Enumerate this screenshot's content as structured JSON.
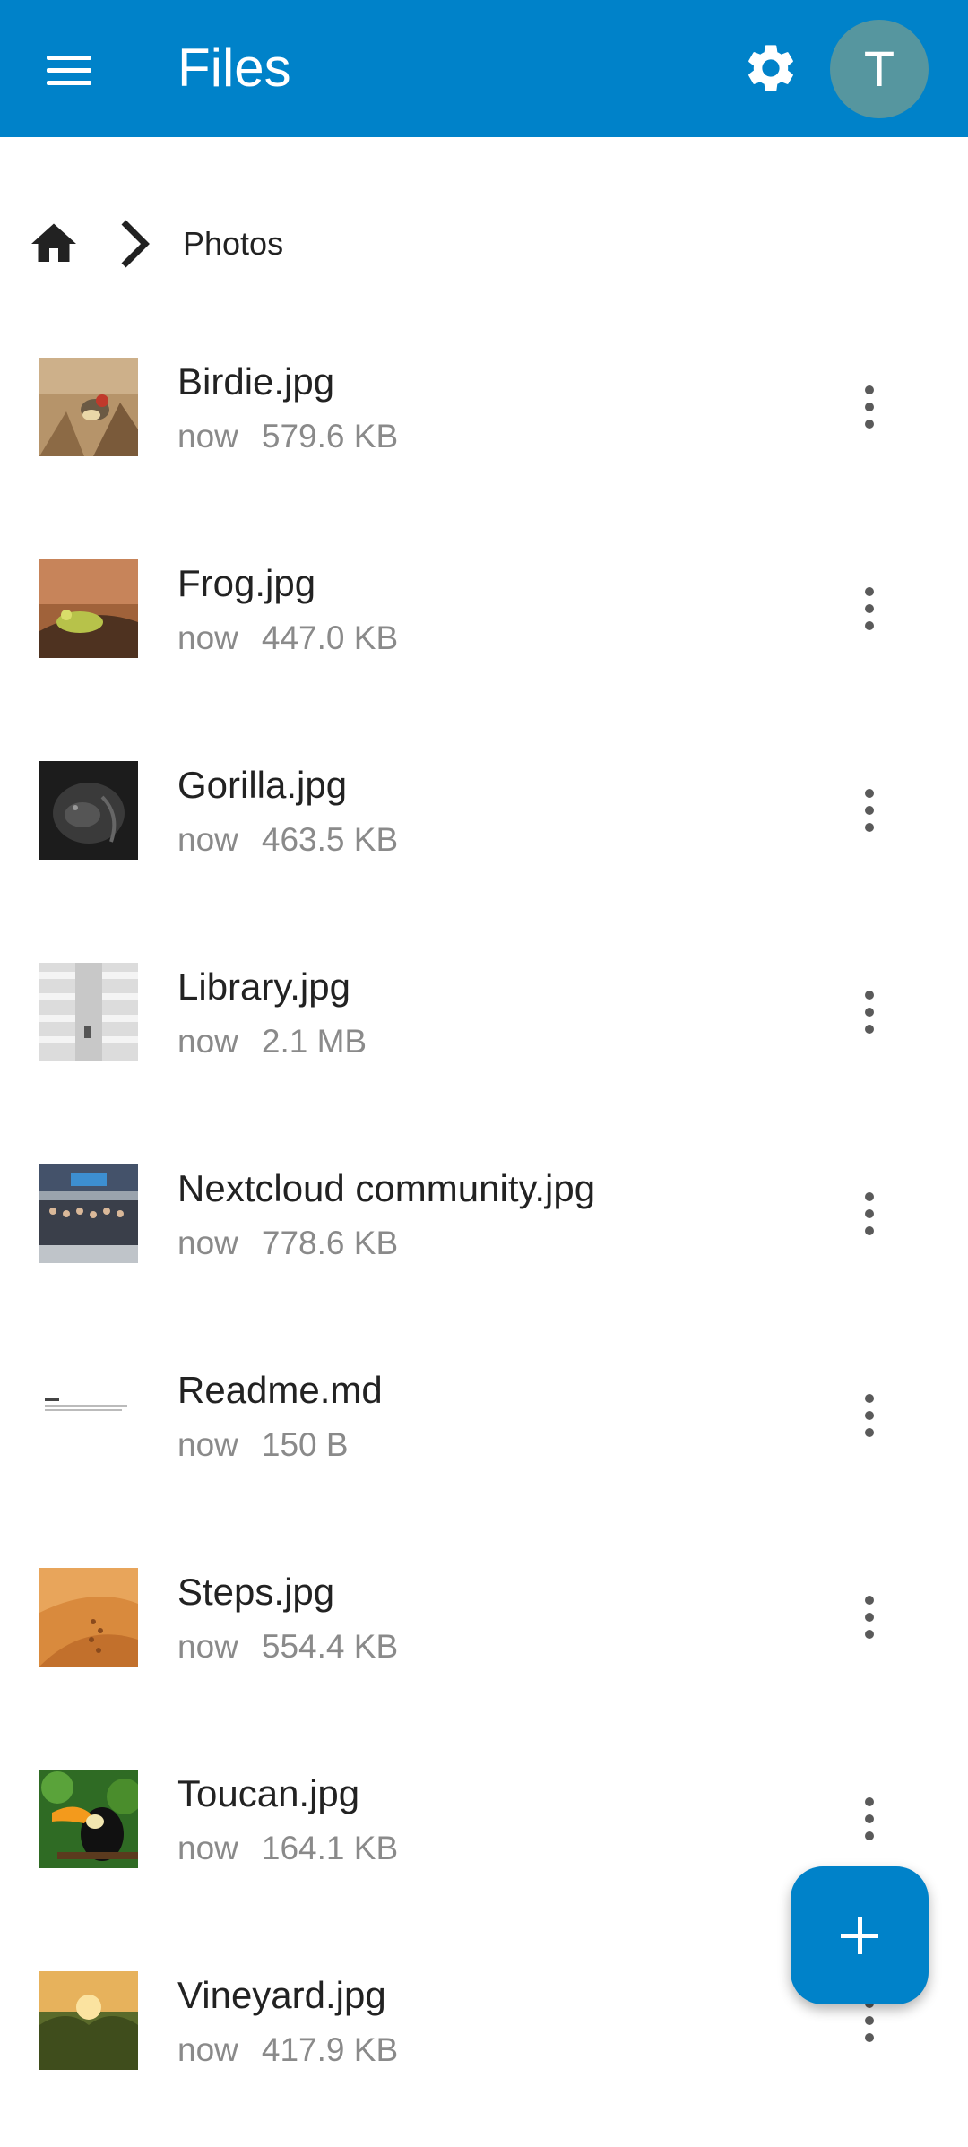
{
  "appbar": {
    "title": "Files",
    "avatar_letter": "T",
    "color": "#0082c9",
    "menu_icon": "hamburger-menu-icon",
    "settings_icon": "gear-icon"
  },
  "breadcrumb": {
    "home_icon": "home-icon",
    "separator_icon": "chevron-right-icon",
    "current": "Photos"
  },
  "files": [
    {
      "name": "Birdie.jpg",
      "modified": "now",
      "size": "579.6 KB",
      "thumb": "bird-photo"
    },
    {
      "name": "Frog.jpg",
      "modified": "now",
      "size": "447.0 KB",
      "thumb": "frog-photo"
    },
    {
      "name": "Gorilla.jpg",
      "modified": "now",
      "size": "463.5 KB",
      "thumb": "gorilla-photo"
    },
    {
      "name": "Library.jpg",
      "modified": "now",
      "size": "2.1 MB",
      "thumb": "library-photo"
    },
    {
      "name": "Nextcloud community.jpg",
      "modified": "now",
      "size": "778.6 KB",
      "thumb": "group-photo"
    },
    {
      "name": "Readme.md",
      "modified": "now",
      "size": "150 B",
      "thumb": "text-document"
    },
    {
      "name": "Steps.jpg",
      "modified": "now",
      "size": "554.4 KB",
      "thumb": "desert-photo"
    },
    {
      "name": "Toucan.jpg",
      "modified": "now",
      "size": "164.1 KB",
      "thumb": "toucan-photo"
    },
    {
      "name": "Vineyard.jpg",
      "modified": "now",
      "size": "417.9 KB",
      "thumb": "vineyard-photo"
    }
  ],
  "fab": {
    "icon": "plus-icon"
  }
}
